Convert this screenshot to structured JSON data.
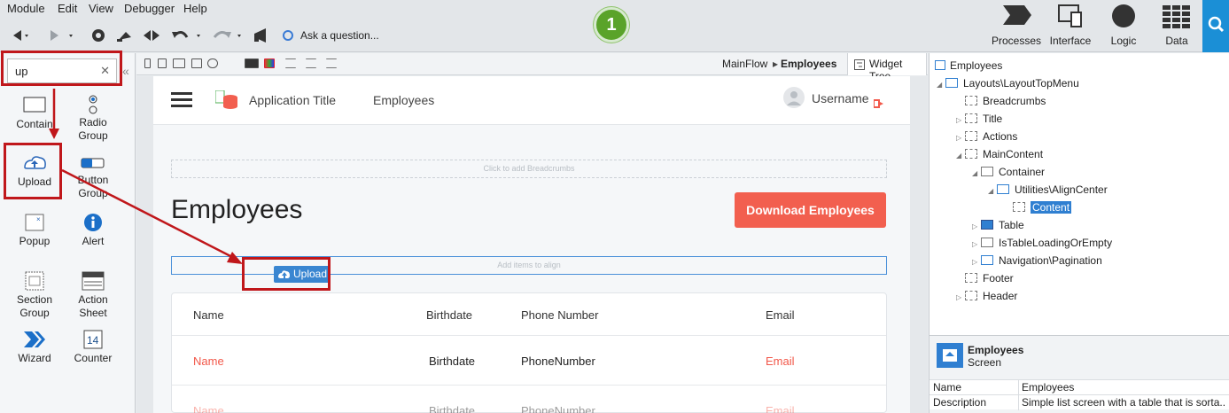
{
  "menu": [
    "Module",
    "Edit",
    "View",
    "Debugger",
    "Help"
  ],
  "toolbar": {
    "ask": "Ask a question..."
  },
  "step_badge": "1",
  "nav_tabs": [
    "Processes",
    "Interface",
    "Logic",
    "Data"
  ],
  "left_panel": {
    "search_value": "up",
    "widgets": [
      {
        "label": "Contain",
        "icon": "container-icon"
      },
      {
        "label": "Radio Group",
        "icon": "radio-icon"
      },
      {
        "label": "Upload",
        "icon": "upload-icon"
      },
      {
        "label": "Button Group",
        "icon": "button-group-icon"
      },
      {
        "label": "Popup",
        "icon": "popup-icon"
      },
      {
        "label": "Alert",
        "icon": "alert-icon"
      },
      {
        "label": "Section Group",
        "icon": "section-group-icon"
      },
      {
        "label": "Action Sheet",
        "icon": "action-sheet-icon"
      },
      {
        "label": "Wizard",
        "icon": "wizard-icon"
      },
      {
        "label": "Counter",
        "icon": "counter-icon"
      }
    ],
    "counter_number": "14"
  },
  "breadcrumb": {
    "flow": "MainFlow",
    "screen": "Employees"
  },
  "widget_tree_tab": "Widget Tree",
  "app": {
    "app_title": "Application Title",
    "menu_employees": "Employees",
    "username": "Username",
    "breadcrumbs_placeholder": "Click to add Breadcrumbs",
    "page_title": "Employees",
    "download_button": "Download Employees",
    "align_placeholder": "Add items to align",
    "upload_chip": "Upload",
    "table": {
      "headers": [
        "Name",
        "Birthdate",
        "Phone Number",
        "Email"
      ],
      "rows": [
        [
          "Name",
          "Birthdate",
          "PhoneNumber",
          "Email"
        ],
        [
          "Name",
          "Birthdate",
          "PhoneNumber",
          "Email"
        ]
      ]
    }
  },
  "tree": {
    "root": "Employees",
    "nodes": [
      "Layouts\\LayoutTopMenu",
      "Breadcrumbs",
      "Title",
      "Actions",
      "MainContent",
      "Container",
      "Utilities\\AlignCenter",
      "Content",
      "Table",
      "IsTableLoadingOrEmpty",
      "Navigation\\Pagination",
      "Footer",
      "Header"
    ]
  },
  "properties": {
    "title": "Employees",
    "subtitle": "Screen",
    "rows": [
      {
        "key": "Name",
        "value": "Employees"
      },
      {
        "key": "Description",
        "value": "Simple list screen with a table that is sorta..."
      }
    ]
  },
  "colors": {
    "accent": "#1b8fd6",
    "highlight": "#c0171b",
    "danger": "#f25f4f",
    "badge": "#5aa32a"
  }
}
